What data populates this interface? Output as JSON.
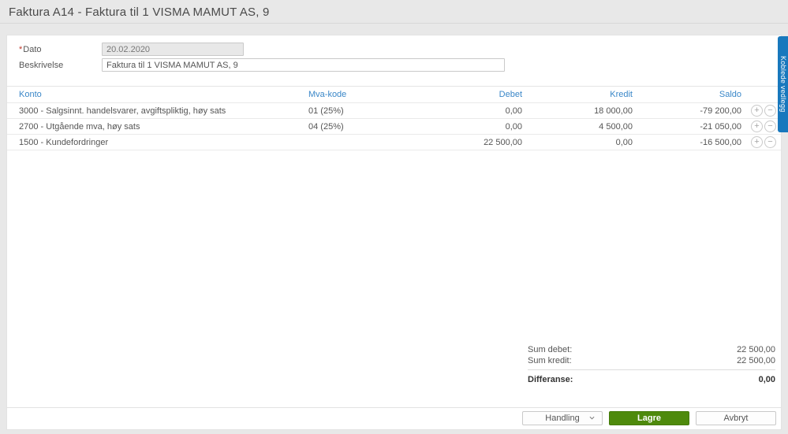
{
  "header": {
    "title": "Faktura A14  -  Faktura til 1 VISMA MAMUT AS, 9"
  },
  "form": {
    "dato": {
      "required_marker": "*",
      "label": "Dato",
      "value": "20.02.2020"
    },
    "beskrivelse": {
      "label": "Beskrivelse",
      "value": "Faktura til 1 VISMA MAMUT AS, 9"
    }
  },
  "table": {
    "columns": [
      "Konto",
      "Mva-kode",
      "Debet",
      "Kredit",
      "Saldo"
    ],
    "rows": [
      {
        "konto": "3000 - Salgsinnt. handelsvarer, avgiftspliktig, høy sats",
        "mva": "01 (25%)",
        "debet": "0,00",
        "kredit": "18 000,00",
        "saldo": "-79 200,00",
        "add_icon": "+",
        "remove_icon": "−"
      },
      {
        "konto": "2700 - Utgående mva, høy sats",
        "mva": "04 (25%)",
        "debet": "0,00",
        "kredit": "4 500,00",
        "saldo": "-21 050,00",
        "add_icon": "+",
        "remove_icon": "−"
      },
      {
        "konto": "1500 - Kundefordringer",
        "mva": "",
        "debet": "22 500,00",
        "kredit": "0,00",
        "saldo": "-16 500,00",
        "add_icon": "+",
        "remove_icon": "−"
      }
    ]
  },
  "summary": {
    "sum_debet_label": "Sum debet:",
    "sum_debet_value": "22 500,00",
    "sum_kredit_label": "Sum kredit:",
    "sum_kredit_value": "22 500,00",
    "differanse_label": "Differanse:",
    "differanse_value": "0,00"
  },
  "footer": {
    "handling_label": "Handling",
    "lagre_label": "Lagre",
    "avbryt_label": "Avbryt"
  },
  "side_tab": {
    "label": "Koblede vedlegg"
  },
  "colors": {
    "accent_blue": "#3a87c8",
    "tab_blue": "#1878bd",
    "save_green": "#4e8a0c",
    "required_red": "#c0392b",
    "page_background": "#e8e8e8"
  }
}
